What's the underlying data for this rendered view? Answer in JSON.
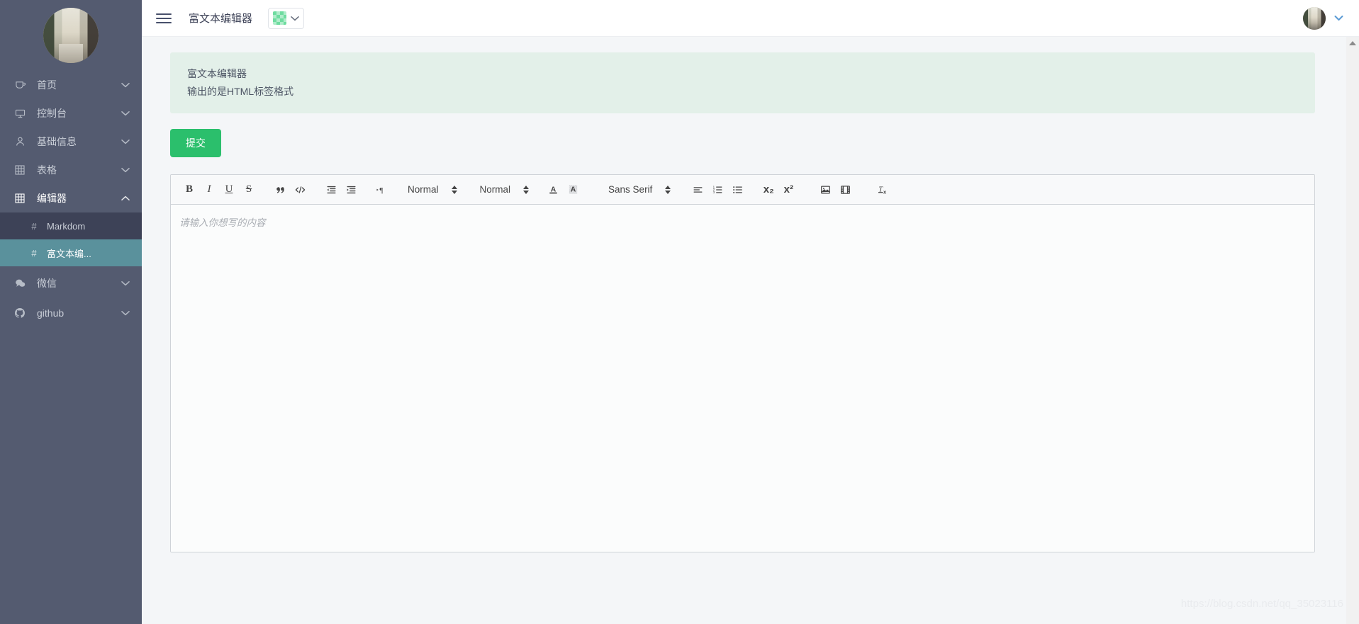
{
  "sidebar": {
    "avatar_alt": "user-avatar-photo",
    "items": [
      {
        "label": "首页",
        "icon": "cup-icon",
        "chevron": "chevron-down",
        "expanded": false
      },
      {
        "label": "控制台",
        "icon": "monitor-icon",
        "chevron": "chevron-down",
        "expanded": false
      },
      {
        "label": "基础信息",
        "icon": "person-icon",
        "chevron": "chevron-down",
        "expanded": false
      },
      {
        "label": "表格",
        "icon": "grid-icon",
        "chevron": "chevron-down",
        "expanded": false
      },
      {
        "label": "编辑器",
        "icon": "grid-icon",
        "chevron": "chevron-up",
        "expanded": true
      }
    ],
    "subitems": [
      {
        "label": "Markdom",
        "icon": "hash-icon",
        "state": "hover"
      },
      {
        "label": "富文本编...",
        "icon": "hash-icon",
        "state": "active"
      }
    ],
    "items_after": [
      {
        "label": "微信",
        "icon": "chat-icon",
        "chevron": "chevron-down",
        "expanded": false
      },
      {
        "label": "github",
        "icon": "github-icon",
        "chevron": "chevron-down",
        "expanded": false
      }
    ]
  },
  "topbar": {
    "menu_icon": "hamburger-icon",
    "title": "富文本编辑器",
    "color_picker": {
      "swatch_color": "#6fdca0",
      "chevron": "chevron-down"
    },
    "avatar_icon": "user-avatar",
    "caret": "chevron-down"
  },
  "content": {
    "alert": {
      "line1": "富文本编辑器",
      "line2": "输出的是HTML标签格式",
      "bg_color": "#e3f0e9"
    },
    "submit_button": {
      "label": "提交",
      "color": "#2bbf6c"
    },
    "editor": {
      "placeholder": "请输入你想写的内容",
      "value": "",
      "toolbar": {
        "group1": [
          {
            "name": "bold-icon",
            "glyph": "B"
          },
          {
            "name": "italic-icon",
            "glyph": "I"
          },
          {
            "name": "underline-icon",
            "glyph": "U"
          },
          {
            "name": "strike-icon",
            "glyph": "S"
          }
        ],
        "group2": [
          {
            "name": "blockquote-icon",
            "glyph": "”"
          },
          {
            "name": "code-block-icon",
            "glyph": "</>"
          }
        ],
        "group3": [
          {
            "name": "outdent-icon",
            "glyph": "outdent"
          },
          {
            "name": "indent-icon",
            "glyph": "indent"
          }
        ],
        "group4": [
          {
            "name": "text-direction-icon",
            "glyph": "¶"
          }
        ],
        "pickers": [
          {
            "name": "header-picker",
            "value": "Normal"
          },
          {
            "name": "size-picker",
            "value": "Normal"
          }
        ],
        "colors": [
          {
            "name": "font-color-icon",
            "glyph": "A"
          },
          {
            "name": "background-color-icon",
            "glyph": "A"
          }
        ],
        "font_picker": {
          "name": "font-picker",
          "value": "Sans Serif"
        },
        "group5": [
          {
            "name": "align-icon",
            "glyph": "align"
          },
          {
            "name": "ordered-list-icon",
            "glyph": "ol"
          },
          {
            "name": "bullet-list-icon",
            "glyph": "ul"
          }
        ],
        "group6": [
          {
            "name": "subscript-icon",
            "glyph": "x₂"
          },
          {
            "name": "superscript-icon",
            "glyph": "x²"
          }
        ],
        "group7": [
          {
            "name": "image-icon",
            "glyph": "image"
          },
          {
            "name": "video-icon",
            "glyph": "video"
          }
        ],
        "group8": [
          {
            "name": "clear-format-icon",
            "glyph": "Tx"
          }
        ]
      }
    }
  },
  "watermark": "https://blog.csdn.net/qq_35023116"
}
